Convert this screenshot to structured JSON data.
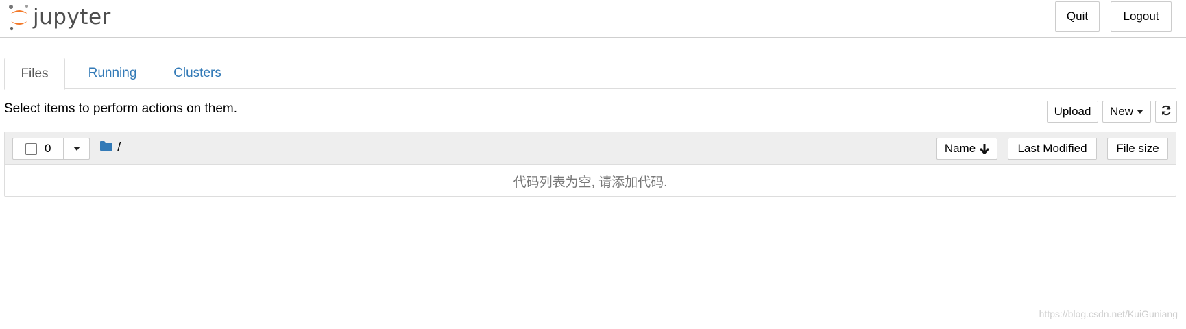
{
  "header": {
    "logo_text": "jupyter",
    "quit_label": "Quit",
    "logout_label": "Logout"
  },
  "tabs": [
    {
      "label": "Files",
      "active": true
    },
    {
      "label": "Running",
      "active": false
    },
    {
      "label": "Clusters",
      "active": false
    }
  ],
  "toolbar": {
    "hint": "Select items to perform actions on them.",
    "upload_label": "Upload",
    "new_label": "New"
  },
  "list": {
    "selected_count": "0",
    "breadcrumb_path": "/",
    "columns": {
      "name": "Name",
      "last_modified": "Last Modified",
      "file_size": "File size"
    },
    "empty_message": "代码列表为空, 请添加代码."
  },
  "watermark": "https://blog.csdn.net/KuiGuniang",
  "colors": {
    "accent": "#337ab7",
    "logo_orange": "#f37726",
    "header_bg": "#ffffff",
    "list_head_bg": "#eeeeee"
  },
  "icons": {
    "logo": "jupyter-logo-icon",
    "folder": "folder-icon",
    "sort": "arrow-down-icon",
    "refresh": "refresh-icon",
    "dropdown": "caret-down-icon"
  }
}
